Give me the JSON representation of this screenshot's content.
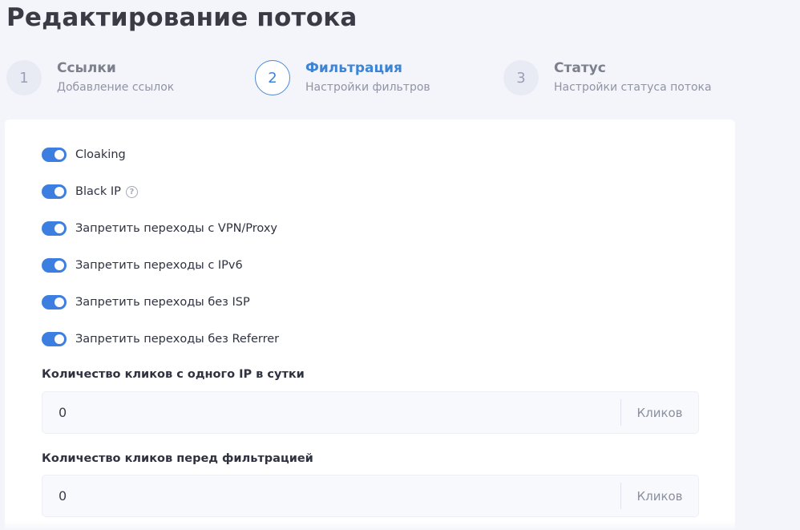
{
  "page": {
    "title": "Редактирование потока"
  },
  "steps": [
    {
      "num": "1",
      "title": "Ссылки",
      "subtitle": "Добавление ссылок",
      "active": false
    },
    {
      "num": "2",
      "title": "Фильтрация",
      "subtitle": "Настройки фильтров",
      "active": true
    },
    {
      "num": "3",
      "title": "Статус",
      "subtitle": "Настройки статуса потока",
      "active": false
    }
  ],
  "toggles": [
    {
      "label": "Cloaking",
      "on": true
    },
    {
      "label": "Black IP",
      "on": true,
      "help_icon": "question-circle-icon"
    },
    {
      "label": "Запретить переходы с VPN/Proxy",
      "on": true
    },
    {
      "label": "Запретить переходы с IPv6",
      "on": true
    },
    {
      "label": "Запретить переходы без ISP",
      "on": true
    },
    {
      "label": "Запретить переходы без Referrer",
      "on": true
    }
  ],
  "fields": {
    "clicks_per_ip": {
      "label": "Количество кликов с одного IP в сутки",
      "value": "0",
      "suffix": "Кликов"
    },
    "clicks_before_filter": {
      "label": "Количество кликов перед фильтрацией",
      "value": "0",
      "suffix": "Кликов"
    }
  },
  "help": {
    "glyph": "?"
  },
  "colors": {
    "accent": "#3c84d6",
    "toggle_on": "#3c7fe0",
    "background": "#f4f5fb"
  }
}
